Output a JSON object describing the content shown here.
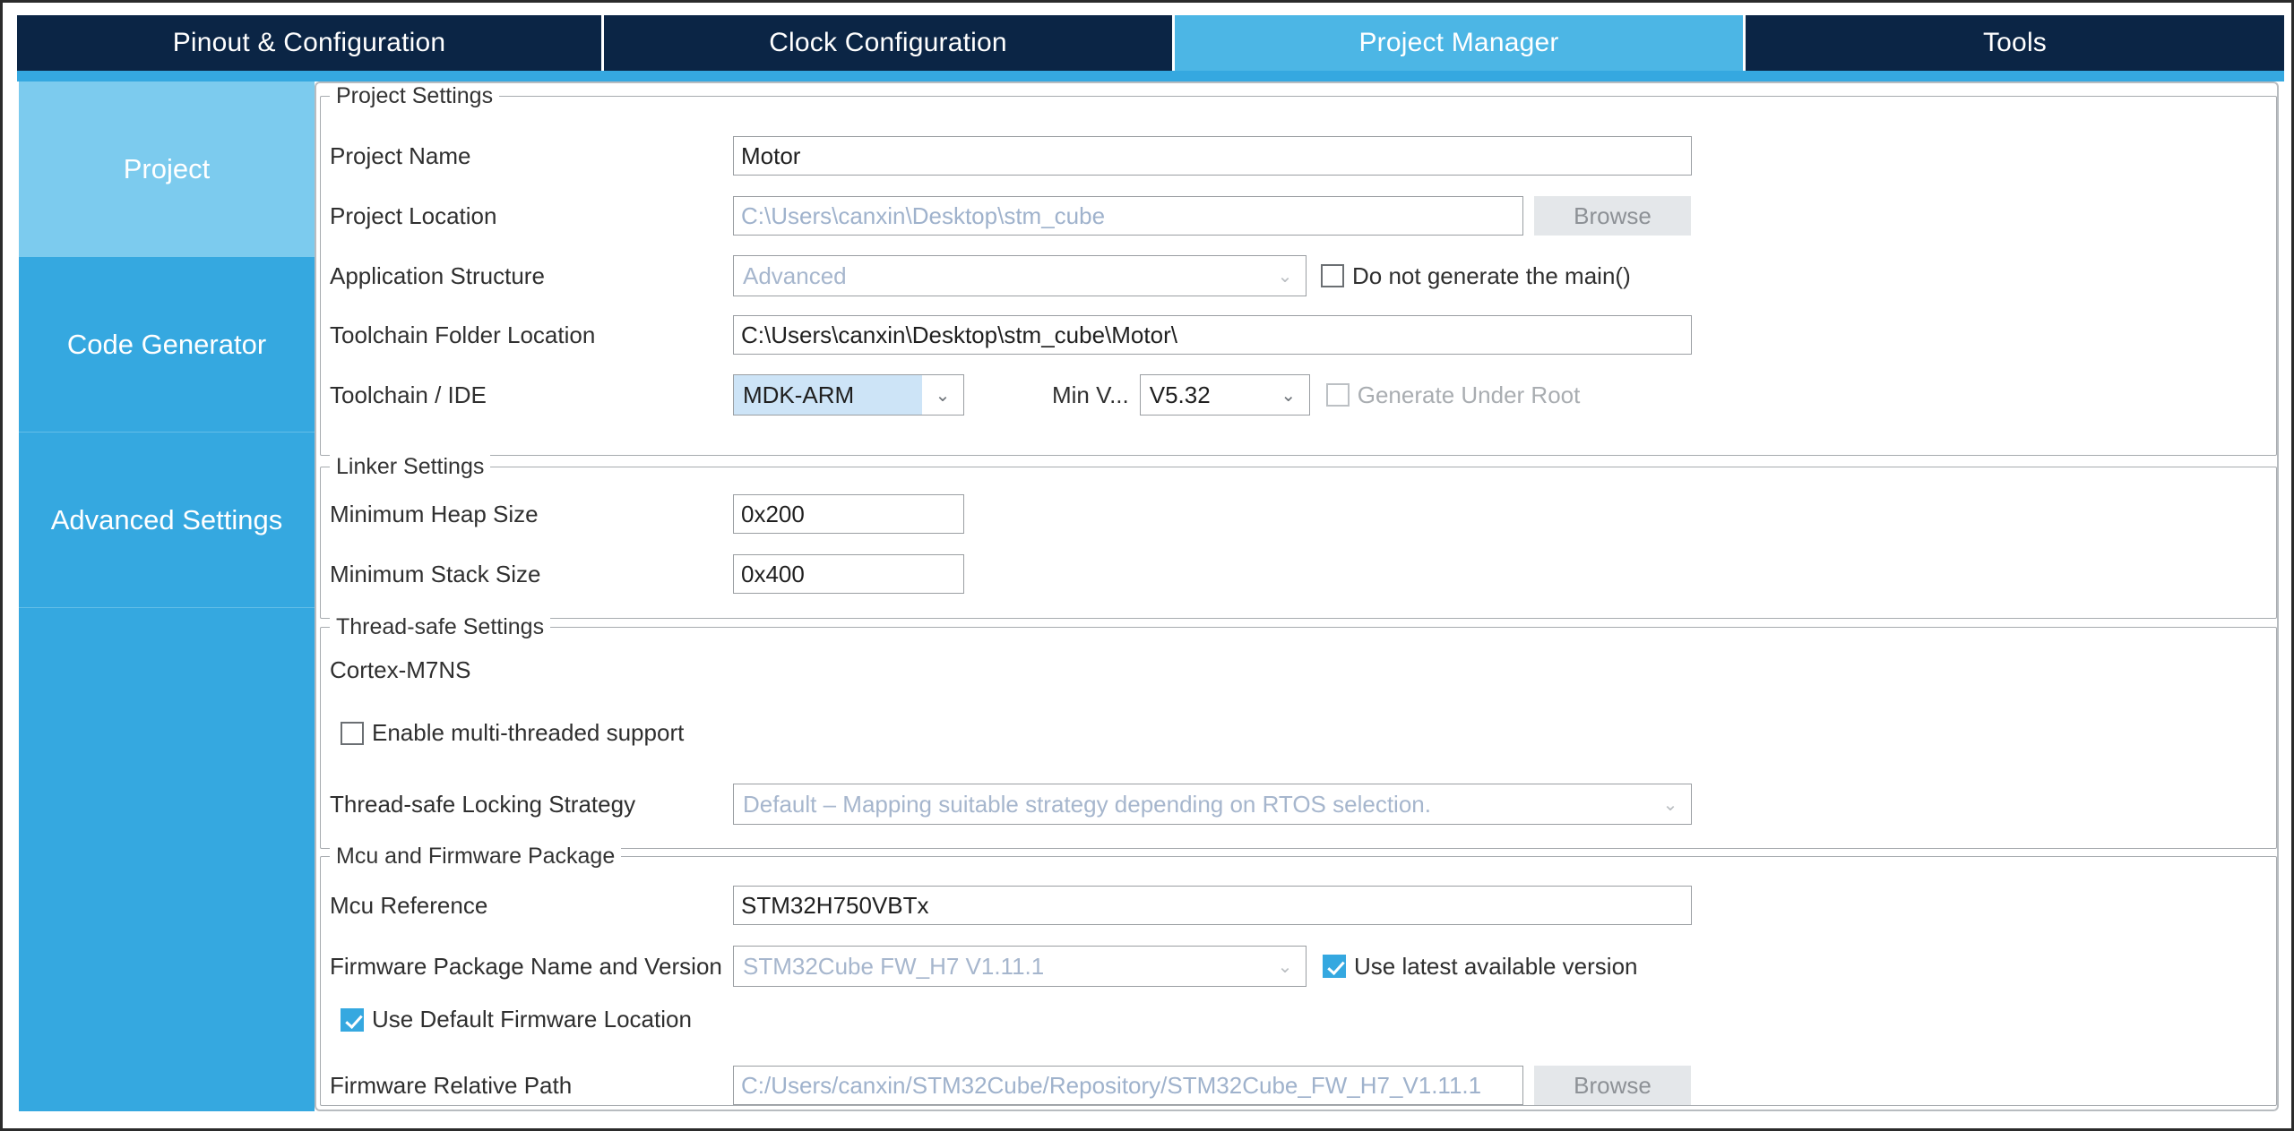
{
  "tabs": [
    {
      "label": "Pinout & Configuration",
      "active": false
    },
    {
      "label": "Clock Configuration",
      "active": false
    },
    {
      "label": "Project Manager",
      "active": true
    },
    {
      "label": "Tools",
      "active": false
    }
  ],
  "sidebar": {
    "items": [
      {
        "label": "Project",
        "active": true
      },
      {
        "label": "Code Generator",
        "active": false
      },
      {
        "label": "Advanced Settings",
        "active": false
      }
    ]
  },
  "project_settings": {
    "legend": "Project Settings",
    "project_name_label": "Project Name",
    "project_name_value": "Motor",
    "project_location_label": "Project Location",
    "project_location_value": "C:\\Users\\canxin\\Desktop\\stm_cube",
    "project_location_browse": "Browse",
    "application_structure_label": "Application Structure",
    "application_structure_value": "Advanced",
    "do_not_generate_main_label": "Do not generate the main()",
    "do_not_generate_main_checked": false,
    "toolchain_folder_label": "Toolchain Folder Location",
    "toolchain_folder_value": "C:\\Users\\canxin\\Desktop\\stm_cube\\Motor\\",
    "toolchain_ide_label": "Toolchain / IDE",
    "toolchain_ide_value": "MDK-ARM",
    "min_version_label": "Min V...",
    "min_version_value": "V5.32",
    "generate_under_root_label": "Generate Under Root",
    "generate_under_root_checked": false
  },
  "linker_settings": {
    "legend": "Linker Settings",
    "min_heap_label": "Minimum Heap Size",
    "min_heap_value": "0x200",
    "min_stack_label": "Minimum Stack Size",
    "min_stack_value": "0x400"
  },
  "thread_safe_settings": {
    "legend": "Thread-safe Settings",
    "core_label": "Cortex-M7NS",
    "enable_multithread_label": "Enable multi-threaded support",
    "enable_multithread_checked": false,
    "locking_strategy_label": "Thread-safe Locking Strategy",
    "locking_strategy_value": "Default  –  Mapping suitable strategy depending on RTOS selection."
  },
  "mcu_firmware": {
    "legend": "Mcu and Firmware Package",
    "mcu_reference_label": "Mcu Reference",
    "mcu_reference_value": "STM32H750VBTx",
    "firmware_package_label": "Firmware Package Name and Version",
    "firmware_package_value": "STM32Cube FW_H7 V1.11.1",
    "use_latest_label": "Use latest available version",
    "use_latest_checked": true,
    "use_default_location_label": "Use Default Firmware Location",
    "use_default_location_checked": true,
    "firmware_relative_path_label": "Firmware Relative Path",
    "firmware_relative_path_value": "C:/Users/canxin/STM32Cube/Repository/STM32Cube_FW_H7_V1.11.1",
    "firmware_browse": "Browse"
  },
  "icons": {
    "chevron_down": "⌄"
  },
  "colors": {
    "tab_inactive": "#0b2545",
    "tab_active": "#4cb6e5",
    "accent": "#35a8e0",
    "sidebar_selected": "#7ccbee",
    "combo_selected": "#cde4f7"
  }
}
